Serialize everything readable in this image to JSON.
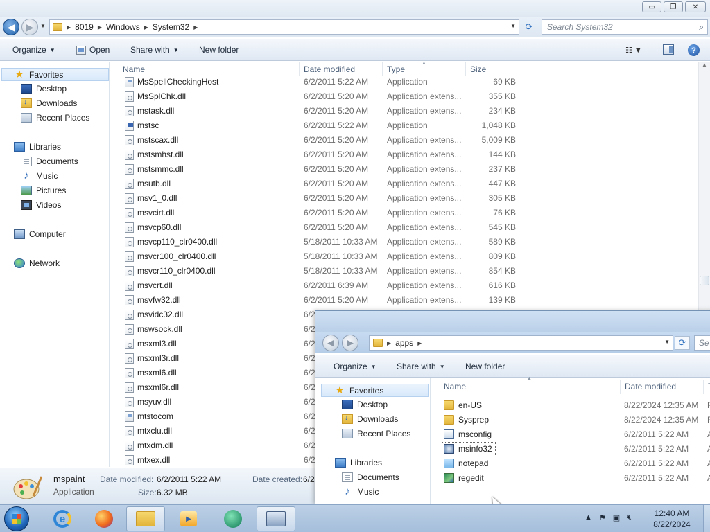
{
  "main_window": {
    "caption_buttons": [
      "▭",
      "❐",
      "✕"
    ],
    "breadcrumb": [
      "8019",
      "Windows",
      "System32"
    ],
    "search_placeholder": "Search System32",
    "toolbar": {
      "organize": "Organize",
      "open": "Open",
      "share_with": "Share with",
      "new_folder": "New folder"
    },
    "nav": {
      "favorites": "Favorites",
      "desktop": "Desktop",
      "downloads": "Downloads",
      "recent_places": "Recent Places",
      "libraries": "Libraries",
      "documents": "Documents",
      "music": "Music",
      "pictures": "Pictures",
      "videos": "Videos",
      "computer": "Computer",
      "network": "Network"
    },
    "columns": {
      "name": "Name",
      "date": "Date modified",
      "type": "Type",
      "size": "Size"
    },
    "files": [
      {
        "name": "MsSpellCheckingHost",
        "date": "6/2/2011 5:22 AM",
        "type": "Application",
        "size": "69 KB",
        "icon": "app"
      },
      {
        "name": "MsSplChk.dll",
        "date": "6/2/2011 5:20 AM",
        "type": "Application extens...",
        "size": "355 KB",
        "icon": "dll"
      },
      {
        "name": "mstask.dll",
        "date": "6/2/2011 5:20 AM",
        "type": "Application extens...",
        "size": "234 KB",
        "icon": "dll"
      },
      {
        "name": "mstsc",
        "date": "6/2/2011 5:22 AM",
        "type": "Application",
        "size": "1,048 KB",
        "icon": "mstsc"
      },
      {
        "name": "mstscax.dll",
        "date": "6/2/2011 5:20 AM",
        "type": "Application extens...",
        "size": "5,009 KB",
        "icon": "dll"
      },
      {
        "name": "mstsmhst.dll",
        "date": "6/2/2011 5:20 AM",
        "type": "Application extens...",
        "size": "144 KB",
        "icon": "dll"
      },
      {
        "name": "mstsmmc.dll",
        "date": "6/2/2011 5:20 AM",
        "type": "Application extens...",
        "size": "237 KB",
        "icon": "dll"
      },
      {
        "name": "msutb.dll",
        "date": "6/2/2011 5:20 AM",
        "type": "Application extens...",
        "size": "447 KB",
        "icon": "dll"
      },
      {
        "name": "msv1_0.dll",
        "date": "6/2/2011 5:20 AM",
        "type": "Application extens...",
        "size": "305 KB",
        "icon": "dll"
      },
      {
        "name": "msvcirt.dll",
        "date": "6/2/2011 5:20 AM",
        "type": "Application extens...",
        "size": "76 KB",
        "icon": "dll"
      },
      {
        "name": "msvcp60.dll",
        "date": "6/2/2011 5:20 AM",
        "type": "Application extens...",
        "size": "545 KB",
        "icon": "dll"
      },
      {
        "name": "msvcp110_clr0400.dll",
        "date": "5/18/2011 10:33 AM",
        "type": "Application extens...",
        "size": "589 KB",
        "icon": "dll"
      },
      {
        "name": "msvcr100_clr0400.dll",
        "date": "5/18/2011 10:33 AM",
        "type": "Application extens...",
        "size": "809 KB",
        "icon": "dll"
      },
      {
        "name": "msvcr110_clr0400.dll",
        "date": "5/18/2011 10:33 AM",
        "type": "Application extens...",
        "size": "854 KB",
        "icon": "dll"
      },
      {
        "name": "msvcrt.dll",
        "date": "6/2/2011 6:39 AM",
        "type": "Application extens...",
        "size": "616 KB",
        "icon": "dll"
      },
      {
        "name": "msvfw32.dll",
        "date": "6/2/2011 5:20 AM",
        "type": "Application extens...",
        "size": "139 KB",
        "icon": "dll"
      },
      {
        "name": "msvidc32.dll",
        "date": "6/2",
        "type": "",
        "size": "",
        "icon": "dll"
      },
      {
        "name": "mswsock.dll",
        "date": "6/2",
        "type": "",
        "size": "",
        "icon": "dll"
      },
      {
        "name": "msxml3.dll",
        "date": "6/2",
        "type": "",
        "size": "",
        "icon": "dll"
      },
      {
        "name": "msxml3r.dll",
        "date": "6/2",
        "type": "",
        "size": "",
        "icon": "dll"
      },
      {
        "name": "msxml6.dll",
        "date": "6/2",
        "type": "",
        "size": "",
        "icon": "dll"
      },
      {
        "name": "msxml6r.dll",
        "date": "6/2",
        "type": "",
        "size": "",
        "icon": "dll"
      },
      {
        "name": "msyuv.dll",
        "date": "6/2",
        "type": "",
        "size": "",
        "icon": "dll"
      },
      {
        "name": "mtstocom",
        "date": "6/2",
        "type": "",
        "size": "",
        "icon": "app"
      },
      {
        "name": "mtxclu.dll",
        "date": "6/2",
        "type": "",
        "size": "",
        "icon": "dll"
      },
      {
        "name": "mtxdm.dll",
        "date": "6/2",
        "type": "",
        "size": "",
        "icon": "dll"
      },
      {
        "name": "mtxex.dll",
        "date": "6/2",
        "type": "",
        "size": "",
        "icon": "dll"
      }
    ],
    "details": {
      "name": "mspaint",
      "type": "Application",
      "date_modified_label": "Date modified:",
      "date_modified": "6/2/2011 5:22 AM",
      "size_label": "Size:",
      "size": "6.32 MB",
      "date_created_label": "Date created:",
      "date_created": "6/2"
    }
  },
  "apps_window": {
    "breadcrumb": [
      "apps"
    ],
    "search_placeholder": "Se",
    "toolbar": {
      "organize": "Organize",
      "share_with": "Share with",
      "new_folder": "New folder"
    },
    "nav": {
      "favorites": "Favorites",
      "desktop": "Desktop",
      "downloads": "Downloads",
      "recent_places": "Recent Places",
      "libraries": "Libraries",
      "documents": "Documents",
      "music": "Music"
    },
    "columns": {
      "name": "Name",
      "date": "Date modified",
      "type_partial": "T"
    },
    "files": [
      {
        "name": "en-US",
        "date": "8/22/2024 12:35 AM",
        "extra": "F",
        "icon": "folder"
      },
      {
        "name": "Sysprep",
        "date": "8/22/2024 12:35 AM",
        "extra": "F",
        "icon": "folder"
      },
      {
        "name": "msconfig",
        "date": "6/2/2011 5:22 AM",
        "extra": "A",
        "icon": "cfg"
      },
      {
        "name": "msinfo32",
        "date": "6/2/2011 5:22 AM",
        "extra": "A",
        "icon": "info"
      },
      {
        "name": "notepad",
        "date": "6/2/2011 5:22 AM",
        "extra": "A",
        "icon": "note"
      },
      {
        "name": "regedit",
        "date": "6/2/2011 5:22 AM",
        "extra": "A",
        "icon": "reg"
      }
    ]
  },
  "taskbar": {
    "time": "12:40 AM",
    "date": "8/22/2024",
    "apps": [
      "internet-explorer",
      "firefox",
      "windows-explorer",
      "media-player",
      "green-app",
      "control-panel"
    ]
  },
  "colors": {
    "accent": "#1e5fa8",
    "folder": "#e2b43b",
    "taskbar": "#a5bedb"
  }
}
